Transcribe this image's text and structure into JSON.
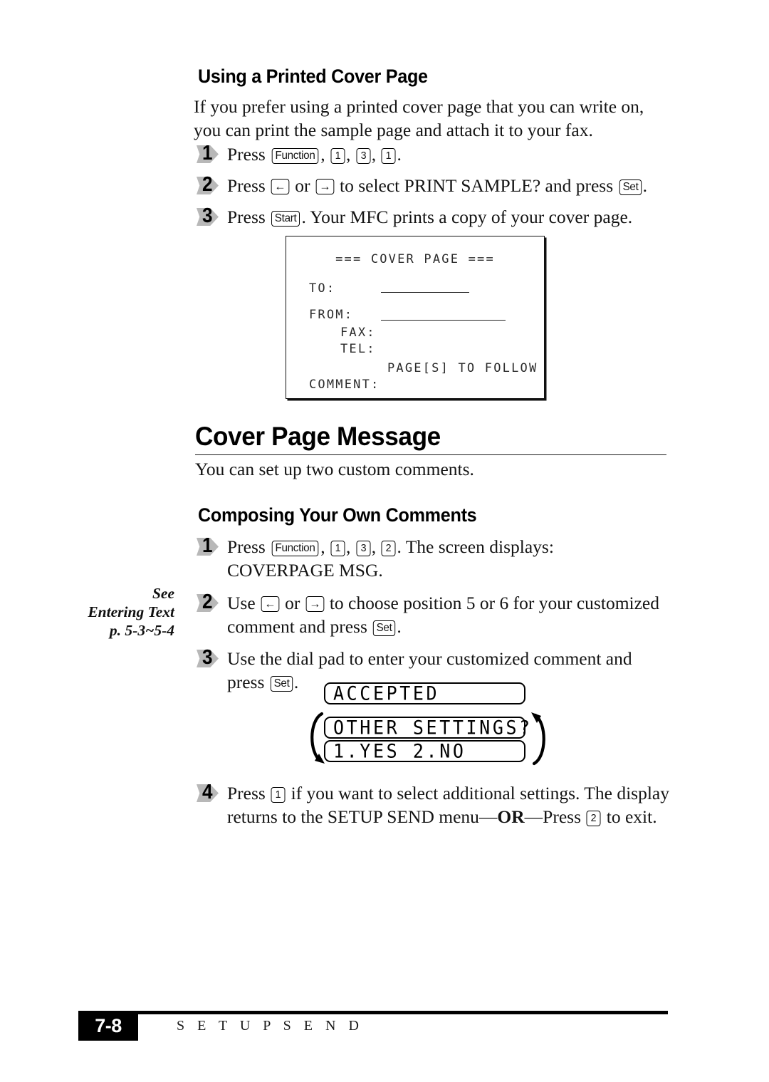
{
  "page": {
    "number": "7-8",
    "running_head": "S E T U P   S E N D"
  },
  "sections": [
    {
      "id": "using-printed-cover-page",
      "heading": "Using a Printed Cover Page",
      "intro": "If you prefer using a printed cover page that you can write on, you can print the sample page and attach it to your fax."
    }
  ],
  "steps_group_1": [
    {
      "num": "1",
      "parts": [
        {
          "type": "text",
          "value": "Press "
        },
        {
          "type": "key",
          "value": "Function"
        },
        {
          "type": "text",
          "value": ", "
        },
        {
          "type": "key",
          "value": "1"
        },
        {
          "type": "text",
          "value": ", "
        },
        {
          "type": "key",
          "value": "3"
        },
        {
          "type": "text",
          "value": ", "
        },
        {
          "type": "key",
          "value": "1"
        },
        {
          "type": "text",
          "value": "."
        }
      ]
    },
    {
      "num": "2",
      "parts": [
        {
          "type": "text",
          "value": "Press "
        },
        {
          "type": "key",
          "value": "←"
        },
        {
          "type": "text",
          "value": " or "
        },
        {
          "type": "key",
          "value": "→"
        },
        {
          "type": "text",
          "value": " to select PRINT SAMPLE? and press "
        },
        {
          "type": "key",
          "value": "Set"
        },
        {
          "type": "text",
          "value": "."
        }
      ]
    },
    {
      "num": "3",
      "parts": [
        {
          "type": "text",
          "value": "Press "
        },
        {
          "type": "key",
          "value": "Start"
        },
        {
          "type": "text",
          "value": ". Your MFC prints a copy of your cover page."
        }
      ]
    }
  ],
  "cover_sample": {
    "title": "=== COVER PAGE ===",
    "to_label": "TO:",
    "from_label": "FROM:",
    "fax_label": "FAX:",
    "tel_label": "TEL:",
    "pages_label": "PAGE[S] TO FOLLOW",
    "comment_label": "COMMENT:"
  },
  "cover_page_message": {
    "heading": "Cover Page Message",
    "intro": "You can set up two custom comments.",
    "sub_heading": "Composing Your Own Comments"
  },
  "sidenote": {
    "line1": "See",
    "line2": "Entering Text",
    "line3": "p. 5-3~5-4"
  },
  "steps_group_2": [
    {
      "num": "1",
      "parts": [
        {
          "type": "text",
          "value": "Press "
        },
        {
          "type": "key",
          "value": "Function"
        },
        {
          "type": "text",
          "value": ", "
        },
        {
          "type": "key",
          "value": "1"
        },
        {
          "type": "text",
          "value": ", "
        },
        {
          "type": "key",
          "value": "3"
        },
        {
          "type": "text",
          "value": ", "
        },
        {
          "type": "key",
          "value": "2"
        },
        {
          "type": "text",
          "value": ". The screen displays:"
        },
        {
          "type": "break"
        },
        {
          "type": "text",
          "value": "COVERPAGE MSG."
        }
      ]
    },
    {
      "num": "2",
      "parts": [
        {
          "type": "text",
          "value": "Use "
        },
        {
          "type": "key",
          "value": "←"
        },
        {
          "type": "text",
          "value": " or "
        },
        {
          "type": "key",
          "value": "→"
        },
        {
          "type": "text",
          "value": " to choose position 5 or 6 for your customized comment and press "
        },
        {
          "type": "key",
          "value": "Set"
        },
        {
          "type": "text",
          "value": "."
        }
      ]
    },
    {
      "num": "3",
      "parts": [
        {
          "type": "text",
          "value": "Use the dial pad to enter your customized comment and press "
        },
        {
          "type": "key",
          "value": "Set"
        },
        {
          "type": "text",
          "value": "."
        }
      ]
    }
  ],
  "lcd_displays": [
    {
      "id": "accepted",
      "text": "ACCEPTED"
    },
    {
      "id": "other-settings",
      "text": "OTHER SETTINGS?"
    },
    {
      "id": "yes-no",
      "text": "1.YES 2.NO"
    }
  ],
  "steps_group_3": [
    {
      "num": "4",
      "parts": [
        {
          "type": "text",
          "value": "Press "
        },
        {
          "type": "key",
          "value": "1"
        },
        {
          "type": "text",
          "value": " if you want to select additional settings. The display returns to the SETUP SEND menu—"
        },
        {
          "type": "bold",
          "value": "OR"
        },
        {
          "type": "text",
          "value": "—Press "
        },
        {
          "type": "key",
          "value": "2"
        },
        {
          "type": "text",
          "value": " to exit."
        }
      ]
    }
  ]
}
